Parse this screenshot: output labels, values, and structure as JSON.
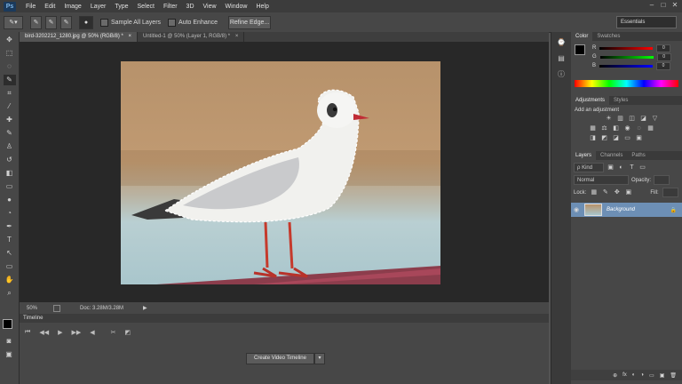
{
  "menubar": {
    "logo": "Ps",
    "items": [
      "File",
      "Edit",
      "Image",
      "Layer",
      "Type",
      "Select",
      "Filter",
      "3D",
      "View",
      "Window",
      "Help"
    ],
    "window_controls": [
      "–",
      "□",
      "✕"
    ]
  },
  "options": {
    "sample_all_layers": "Sample All Layers",
    "auto_enhance": "Auto Enhance",
    "refine_edge": "Refine Edge...",
    "workspace": "Essentials"
  },
  "doc_tabs": [
    {
      "label": "bird-3202212_1280.jpg @ 50% (RGB/8) *",
      "close": "×"
    },
    {
      "label": "Untitled-1 @ 50% (Layer 1, RGB/8) *",
      "close": "×"
    }
  ],
  "status": {
    "zoom": "50%",
    "doc": "Doc: 3.28M/3.28M",
    "arrow": "▶"
  },
  "timeline": {
    "title": "Timeline",
    "create_label": "Create Video Timeline",
    "dropdown": "▾"
  },
  "panels": {
    "color_tabs": [
      "Color",
      "Swatches"
    ],
    "channels": [
      {
        "label": "R",
        "value": "0"
      },
      {
        "label": "G",
        "value": "0"
      },
      {
        "label": "B",
        "value": "0"
      }
    ],
    "adjust_tabs": [
      "Adjustments",
      "Styles"
    ],
    "add_adjustment": "Add an adjustment",
    "layers_tabs": [
      "Layers",
      "Channels",
      "Paths"
    ],
    "kind": "ρ Kind",
    "blend_mode": "Normal",
    "opacity_label": "Opacity:",
    "lock_label": "Lock:",
    "fill_label": "Fill:",
    "layer_name": "Background",
    "layer_lock": "🔒",
    "footer_icons": [
      "⊕",
      "fx",
      "◐",
      "◑",
      "▭",
      "▣",
      "🗑"
    ]
  },
  "colors": {
    "menubar": "#3c3c3c",
    "panel": "#474747",
    "canvas": "#282828",
    "selected_layer": "#6d8fb5"
  }
}
